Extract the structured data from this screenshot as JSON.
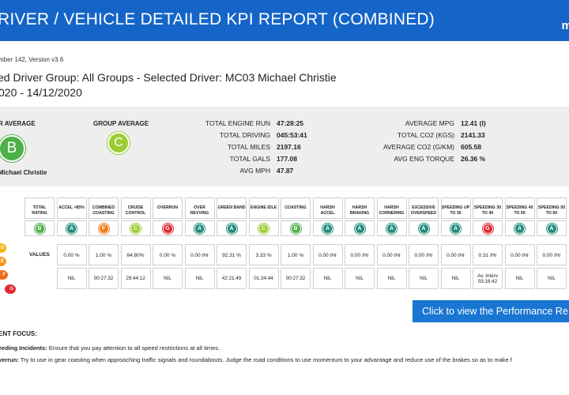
{
  "header": {
    "title": "RIVER / VEHICLE DETAILED KPI REPORT (COMBINED)",
    "logo_text": "mi"
  },
  "meta": {
    "version_line": "mber 142, Version v3.6",
    "title_line": "ed Driver Group: All Groups - Selected Driver: MC03 Michael Christie",
    "date_line": "020 - 14/12/2020"
  },
  "summary": {
    "driver_avg_label": "R AVERAGE",
    "driver_grade": "B",
    "driver_name": "Michael Christie",
    "group_avg_label": "GROUP AVERAGE",
    "group_grade": "C",
    "stats_left": [
      {
        "label": "TOTAL ENGINE RUN",
        "value": "47:28:25"
      },
      {
        "label": "TOTAL DRIVING",
        "value": "045:53:41"
      },
      {
        "label": "TOTAL MILES",
        "value": "2197.16"
      },
      {
        "label": "TOTAL GALS",
        "value": "177.08"
      },
      {
        "label": "AVG MPH",
        "value": "47.87"
      }
    ],
    "stats_right": [
      {
        "label": "AVERAGE MPG",
        "value": "12.41 (I)"
      },
      {
        "label": "TOTAL CO2 (KGS)",
        "value": "2141.33"
      },
      {
        "label": "AVERAGE CO2 (G/KM)",
        "value": "605.58"
      },
      {
        "label": "AVG ENG TORQUE",
        "value": "26.36 %"
      }
    ]
  },
  "kpi": {
    "values_label": "VALUES",
    "columns": [
      {
        "header": "TOTAL RATING",
        "grade": "B",
        "value": "",
        "extra": ""
      },
      {
        "header": "ACCEL >85%",
        "grade": "A",
        "value": "0.00 %",
        "extra": "NIL"
      },
      {
        "header": "COMBINED COASTING",
        "grade": "F",
        "value": "1.00 %",
        "extra": "00:27:32"
      },
      {
        "header": "CRUISE CONTROL",
        "grade": "C",
        "value": "64.80%",
        "extra": "29:44:12"
      },
      {
        "header": "OVERRUN",
        "grade": "G",
        "value": "0.00 %",
        "extra": "NIL"
      },
      {
        "header": "OVER REVVING",
        "grade": "A",
        "value": "0.00 /Hr",
        "extra": "NIL"
      },
      {
        "header": "GREEN BAND",
        "grade": "A",
        "value": "92.31 %",
        "extra": "42:21:49"
      },
      {
        "header": "ENGINE IDLE",
        "grade": "C",
        "value": "3.33 %",
        "extra": "01:34:44"
      },
      {
        "header": "COASTING",
        "grade": "B",
        "value": "1.00 %",
        "extra": "00:27:32"
      },
      {
        "header": "HARSH ACCEL",
        "grade": "A",
        "value": "0.00 /Hr",
        "extra": "NIL"
      },
      {
        "header": "HARSH BRAKING",
        "grade": "A",
        "value": "0.00 /Hr",
        "extra": "NIL"
      },
      {
        "header": "HARSH CORNERING",
        "grade": "A",
        "value": "0.00 /Hr",
        "extra": "NIL"
      },
      {
        "header": "EXCESSIVE OVERSPEED",
        "grade": "A",
        "value": "0.00 /Hr",
        "extra": "NIL"
      },
      {
        "header": "SPEEDING UP TO 30",
        "grade": "A",
        "value": "0.00 /Hr",
        "extra": "NIL"
      },
      {
        "header": "SPEEDING 30 TO 40",
        "grade": "G",
        "value": "0.31 /Hr",
        "extra": "Av. Interv 03:16:42"
      },
      {
        "header": "SPEEDING 40 TO 50",
        "grade": "A",
        "value": "0.00 /Hr",
        "extra": "NIL"
      },
      {
        "header": "SPEEDING 50 TO 60",
        "grade": "A",
        "value": "0.00 /Hr",
        "extra": "NIL"
      }
    ],
    "legend": [
      {
        "grade": "D",
        "color": "#f5b400"
      },
      {
        "grade": "E",
        "color": "#f59a1b"
      },
      {
        "grade": "F",
        "color": "#ef6c1a"
      },
      {
        "grade": "G",
        "color": "#e0272b"
      }
    ]
  },
  "grade_colors": {
    "A": "#1f8a78",
    "B": "#4db048",
    "C": "#9acd32",
    "F": "#f07a1a",
    "G": "#e0272b"
  },
  "performance_button": {
    "label": "Click to view the Performance Re"
  },
  "focus": {
    "heading": "ENT FOCUS:",
    "lines": [
      {
        "bold": "eeding Incidents:",
        "text": " Ensure that you pay attention to all speed restrictions at all times."
      },
      {
        "bold": "verrun:",
        "text": " Try to use in gear coasting when approaching traffic signals and roundabouts. Judge the road conditions to use momentum to your advantage and reduce use of the brakes so as to make f"
      }
    ]
  }
}
